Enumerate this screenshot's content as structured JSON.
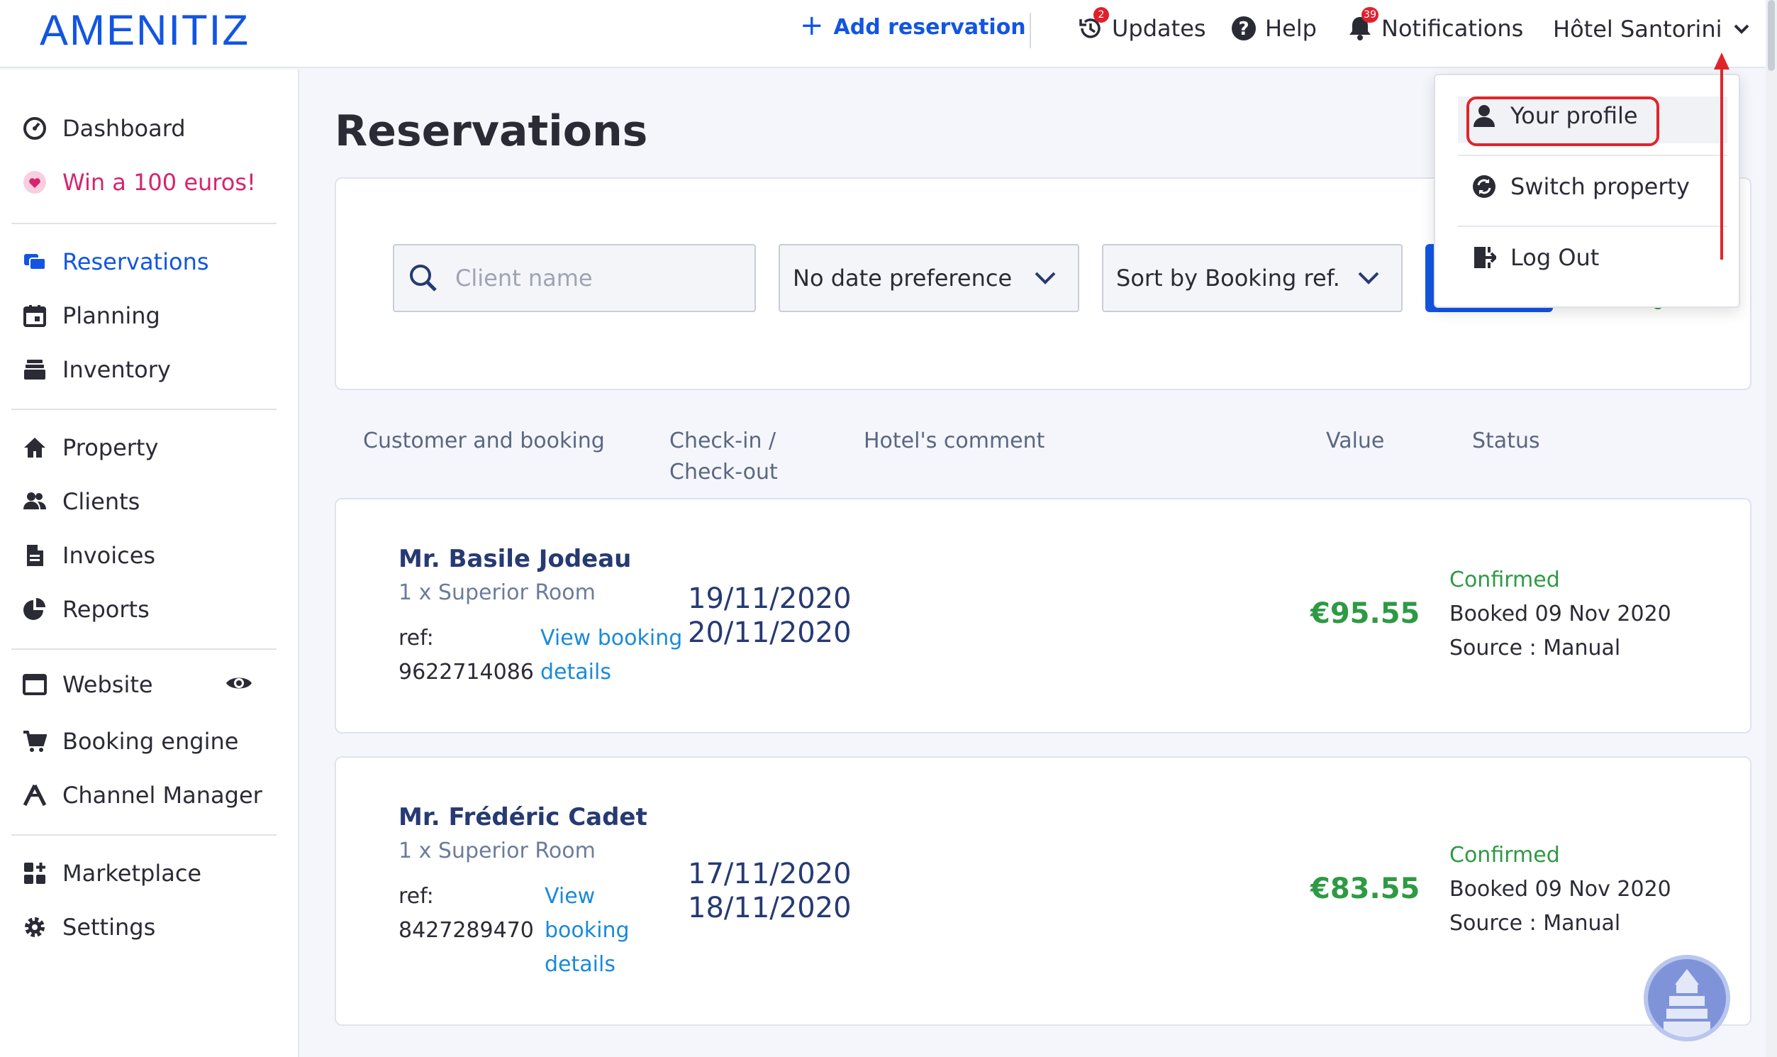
{
  "brand": {
    "logo": "AMENITIZ"
  },
  "topbar": {
    "add_reservation": "Add reservation",
    "updates": {
      "label": "Updates",
      "badge": "2"
    },
    "help": "Help",
    "notifications": {
      "label": "Notifications",
      "badge": "39"
    },
    "hotel": "Hôtel Santorini"
  },
  "sidebar": {
    "dashboard": "Dashboard",
    "promo": "Win a 100 euros!",
    "reservations": "Reservations",
    "planning": "Planning",
    "inventory": "Inventory",
    "property": "Property",
    "clients": "Clients",
    "invoices": "Invoices",
    "reports": "Reports",
    "website": "Website",
    "booking_engine": "Booking engine",
    "channel_manager": "Channel Manager",
    "marketplace": "Marketplace",
    "settings": "Settings"
  },
  "main": {
    "title": "Reservations",
    "filters": {
      "client_placeholder": "Client name",
      "date_pref": "No date preference",
      "sort": "Sort by Booking ref."
    },
    "columns": {
      "customer": "Customer and booking",
      "checkin_line1": "Check-in /",
      "checkin_line2": "Check-out",
      "comment": "Hotel's comment",
      "value": "Value",
      "status": "Status"
    },
    "reservations": [
      {
        "name": "Mr. Basile Jodeau",
        "room": "1 x Superior Room",
        "ref_label": "ref:",
        "ref": "9622714086",
        "link_line1": "View booking",
        "link_line2": "details",
        "checkin": "19/11/2020",
        "checkout": "20/11/2020",
        "value": "€95.55",
        "status": "Confirmed",
        "booked": "Booked 09 Nov 2020",
        "source": "Source : Manual"
      },
      {
        "name": "Mr. Frédéric Cadet",
        "room": "1 x Superior Room",
        "ref_label": "ref:",
        "ref": "8427289470",
        "link_line1": "View",
        "link_line2": "booking",
        "link_line3": "details",
        "checkin": "17/11/2020",
        "checkout": "18/11/2020",
        "value": "€83.55",
        "status": "Confirmed",
        "booked": "Booked 09 Nov 2020",
        "source": "Source : Manual"
      }
    ]
  },
  "profile_menu": {
    "your_profile": "Your profile",
    "switch_property": "Switch property",
    "log_out": "Log Out"
  },
  "colors": {
    "brand_blue": "#1255e3",
    "confirmed_green": "#2e9a44",
    "promo_pink": "#d6246e",
    "annotation_red": "#e0252a"
  }
}
